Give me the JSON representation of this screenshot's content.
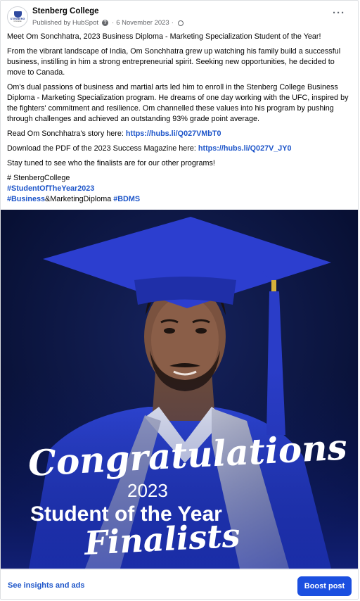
{
  "post": {
    "page_name": "Stenberg College",
    "avatar_logo": "STENBERG",
    "avatar_logo_sub": "COLLEGE",
    "published_by": "Published by HubSpot",
    "help_icon_glyph": "?",
    "date": "6 November 2023",
    "more_label": "···",
    "icons": [
      "help-icon",
      "globe-icon",
      "more-options-icon",
      "graduation-cap-icon"
    ],
    "paragraphs": [
      "Meet Om Sonchhatra, 2023 Business Diploma - Marketing Specialization Student of the Year!",
      "From the vibrant landscape of India, Om Sonchhatra grew up watching his family build a successful business, instilling in him a strong entrepreneurial spirit. Seeking new opportunities, he decided to move to Canada.",
      "Om's dual passions of business and martial arts led him to enroll in the Stenberg College Business Diploma - Marketing Specialization program. He dreams of one day working with the UFC, inspired by the fighters' commitment and resilience. Om channelled these values into his program by pushing through challenges and achieved an outstanding 93% grade point average."
    ],
    "story_prefix": "Read Om Sonchhatra's story here: ",
    "story_link": "https://hubs.li/Q027VMbT0",
    "pdf_prefix": "Download the PDF of the 2023 Success Magazine here: ",
    "pdf_link": "https://hubs.li/Q027V_JY0",
    "stay_tuned": "Stay tuned to see who the finalists are for our other programs!",
    "tag_plain": "# StenbergCollege",
    "tag_soty": "#StudentOfTheYear2023",
    "tag_business": "#Business",
    "tag_marketing": "&MarketingDiploma ",
    "tag_bdms": "#BDMS"
  },
  "image": {
    "congrats": "Congratulations",
    "year": "2023",
    "soty": "Student of the Year",
    "finalists": "Finalists"
  },
  "footer": {
    "insights_label": "See insights and ads",
    "boost_label": "Boost post"
  },
  "colors": {
    "link": "#1d55c9",
    "boost_button": "#1b4fe0",
    "image_bg": "#071239",
    "gown": "#2a3fc4"
  }
}
